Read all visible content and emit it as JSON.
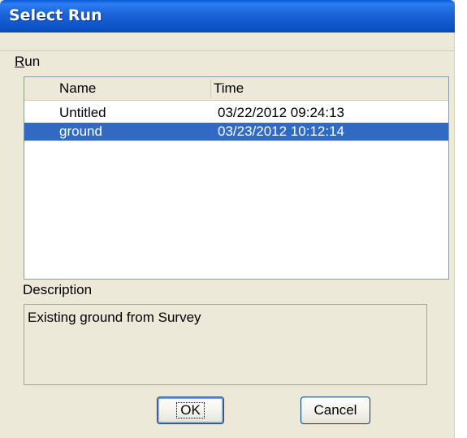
{
  "window": {
    "title": "Select Run"
  },
  "menu": {
    "items": [
      {
        "prefix": "",
        "accel": "R",
        "rest": "un"
      }
    ]
  },
  "runs_list": {
    "columns": [
      "Name",
      "Time"
    ],
    "rows": [
      {
        "name": "Untitled",
        "time": "03/22/2012 09:24:13",
        "selected": false
      },
      {
        "name": "ground",
        "time": "03/23/2012 10:12:14",
        "selected": true
      }
    ]
  },
  "description": {
    "label": "Description",
    "text": "Existing ground from Survey"
  },
  "buttons": {
    "ok_label": "OK",
    "cancel_label": "Cancel"
  },
  "colors": {
    "selection": "#316AC5",
    "titlebar": "#0A58D6",
    "dialog_bg": "#ECE9D8"
  }
}
